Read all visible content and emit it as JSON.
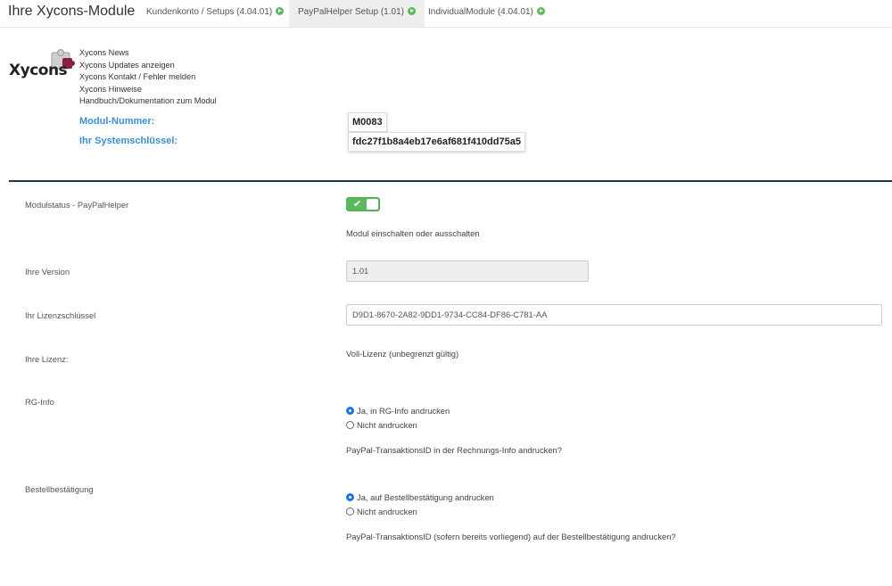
{
  "app_title": "Ihre Xycons-Module",
  "tabs": [
    {
      "label": "Kundenkonto / Setups (4.04.01)",
      "active": false
    },
    {
      "label": "PayPalHelper Setup (1.01)",
      "active": true
    },
    {
      "label": "IndividualModule (4.04.01)",
      "active": false
    }
  ],
  "logo": {
    "text": "Xycons"
  },
  "links": [
    "Xycons News",
    "Xycons Updates anzeigen",
    "Xycons Kontakt / Fehler melden",
    "Xycons Hinweise",
    "Handbuch/Dokumentation zum Modul"
  ],
  "module_number": {
    "label": "Modul-Nummer:",
    "value": "M0083"
  },
  "system_key": {
    "label": "Ihr Systemschlüssel:",
    "value": "fdc27f1b8a4eb17e6af681f410dd75a5"
  },
  "status": {
    "label": "Modulstatus - PayPalHelper",
    "enabled": true,
    "help": "Modul einschalten oder ausschalten"
  },
  "version": {
    "label": "Ihre Version",
    "value": "1.01"
  },
  "license_key": {
    "label": "Ihr Lizenzschlüssel",
    "value": "D9D1-8670-2A82-9DD1-9734-CC84-DF86-C781-AA"
  },
  "license": {
    "label": "Ihre Lizenz:",
    "value": "Voll-Lizenz (unbegrenzt gültig)"
  },
  "rg_info": {
    "label": "RG-Info",
    "option_yes": "Ja, in RG-Info andrucken",
    "option_no": "Nicht andrucken",
    "help": "PayPal-TransaktionsID in der Rechnungs-Info andrucken?"
  },
  "order_confirm": {
    "label": "Bestellbestätigung",
    "option_yes": "Ja, auf Bestellbestätigung andrucken",
    "option_no": "Nicht andrucken",
    "help": "PayPal-TransaktionsID (sofern bereits vorliegend) auf der Bestellbestätigung andrucken?"
  },
  "colors": {
    "accent": "#3a8fd4",
    "success": "#5cb85c",
    "divider": "#1f3650"
  }
}
